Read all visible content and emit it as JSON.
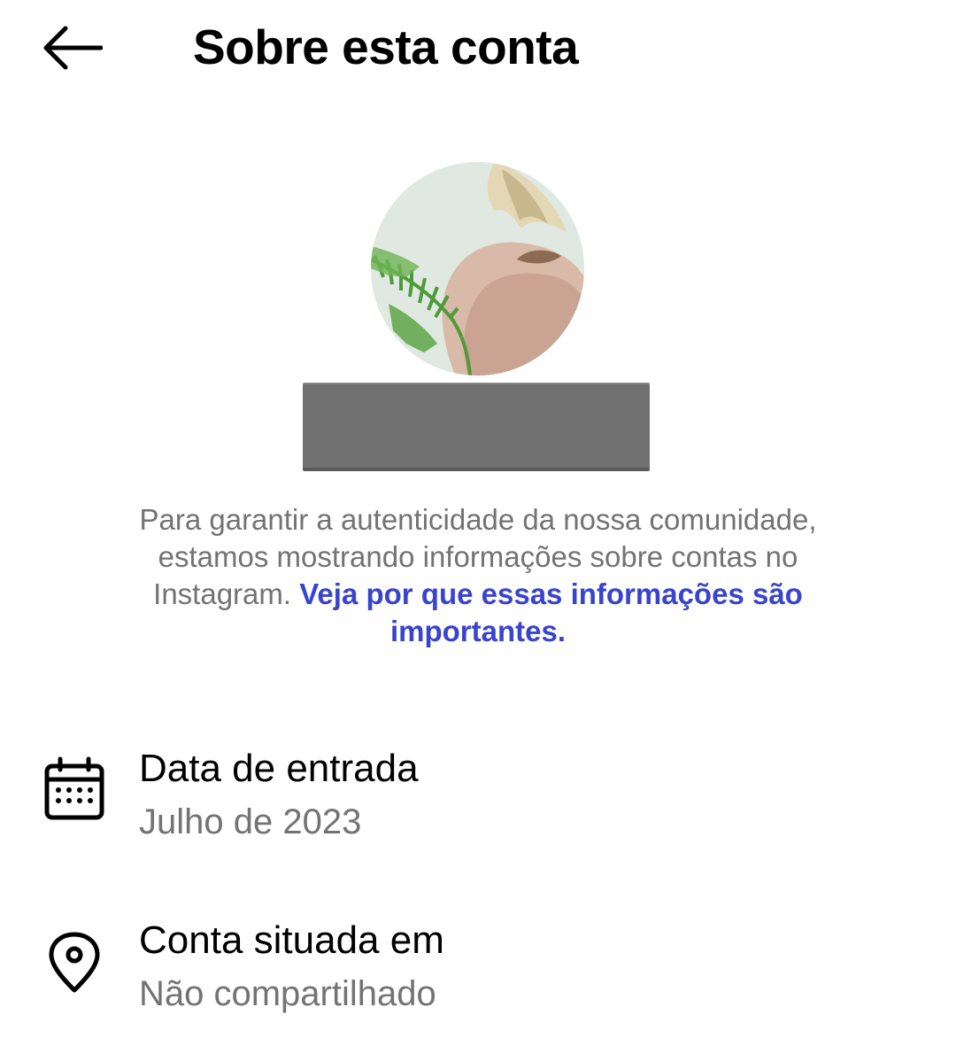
{
  "header": {
    "title": "Sobre esta conta",
    "back_icon": "arrow-left-icon"
  },
  "profile": {
    "avatar_alt": "profile-photo"
  },
  "description": {
    "text": "Para garantir a autenticidade da nossa comunidade, estamos mostrando informações sobre contas no Instagram.",
    "link": "Veja por que essas informações são importantes."
  },
  "rows": [
    {
      "icon": "calendar-icon",
      "label": "Data de entrada",
      "value": "Julho de 2023"
    },
    {
      "icon": "location-pin-icon",
      "label": "Conta situada em",
      "value": "Não compartilhado"
    }
  ],
  "colors": {
    "link": "#3843d0",
    "secondary_text": "#737373",
    "primary_text": "#000000",
    "redaction": "#717171"
  }
}
